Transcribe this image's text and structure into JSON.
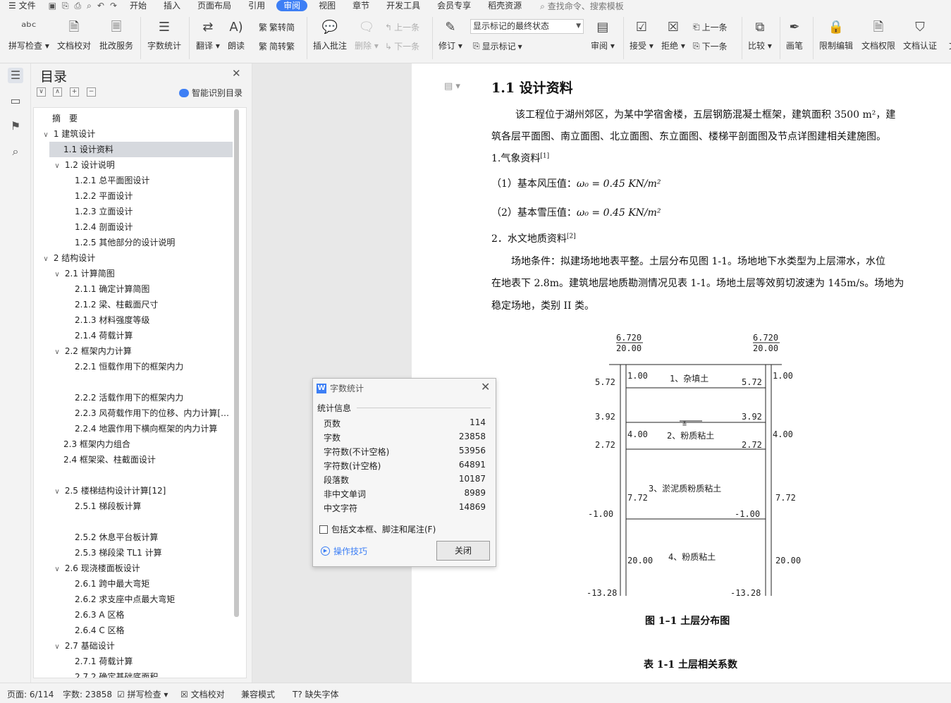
{
  "menubar": {
    "file": "文件",
    "tabs": [
      "开始",
      "插入",
      "页面布局",
      "引用",
      "审阅",
      "视图",
      "章节",
      "开发工具",
      "会员专享",
      "稻壳资源"
    ],
    "active_tab": "审阅",
    "search_placeholder": "查找命令、搜索模板"
  },
  "ribbon": {
    "spell_check": "拼写检查",
    "doc_proof": "文档校对",
    "revise_service": "批改服务",
    "word_count": "字数统计",
    "translate": "翻译",
    "read_aloud": "朗读",
    "trad_to_simp": "繁转简",
    "simp_to_trad": "简转繁",
    "insert_comment": "插入批注",
    "delete": "删除",
    "prev_comment": "上一条",
    "next_comment": "下一条",
    "track_changes": "修订",
    "markup_select": "显示标记的最终状态",
    "show_markup": "显示标记",
    "review": "审阅",
    "accept": "接受",
    "reject": "拒绝",
    "prev_change": "上一条",
    "next_change": "下一条",
    "compare": "比较",
    "pen": "画笔",
    "restrict_edit": "限制编辑",
    "doc_permission": "文档权限",
    "doc_cert": "文档认证",
    "cut_off": "文"
  },
  "nav": {
    "title": "目录",
    "smart_toc": "智能识别目录",
    "items": [
      {
        "text": "摘　要",
        "level": 0,
        "toggle": ""
      },
      {
        "text": "1  建筑设计",
        "level": 0,
        "toggle": "∨"
      },
      {
        "text": "1.1  设计资料",
        "level": 1,
        "toggle": "",
        "selected": true
      },
      {
        "text": "1.2 设计说明",
        "level": 1,
        "toggle": "∨"
      },
      {
        "text": "1.2.1 总平面图设计",
        "level": 2,
        "toggle": ""
      },
      {
        "text": "1.2.2  平面设计",
        "level": 2,
        "toggle": ""
      },
      {
        "text": "1.2.3  立面设计",
        "level": 2,
        "toggle": ""
      },
      {
        "text": "1.2.4  剖面设计",
        "level": 2,
        "toggle": ""
      },
      {
        "text": "1.2.5  其他部分的设计说明",
        "level": 2,
        "toggle": ""
      },
      {
        "text": "2  结构设计",
        "level": 0,
        "toggle": "∨"
      },
      {
        "text": "2.1 计算简图",
        "level": 1,
        "toggle": "∨"
      },
      {
        "text": "2.1.1 确定计算简图",
        "level": 2,
        "toggle": ""
      },
      {
        "text": "2.1.2 梁、柱截面尺寸",
        "level": 2,
        "toggle": ""
      },
      {
        "text": "2.1.3 材料强度等级",
        "level": 2,
        "toggle": ""
      },
      {
        "text": "2.1.4 荷载计算",
        "level": 2,
        "toggle": ""
      },
      {
        "text": "2.2 框架内力计算",
        "level": 1,
        "toggle": "∨"
      },
      {
        "text": "2.2.1 恒载作用下的框架内力",
        "level": 2,
        "toggle": ""
      },
      {
        "text": "",
        "level": 2,
        "toggle": ""
      },
      {
        "text": "2.2.2 活载作用下的框架内力",
        "level": 2,
        "toggle": ""
      },
      {
        "text": "2.2.3 风荷载作用下的位移、内力计算[…",
        "level": 2,
        "toggle": ""
      },
      {
        "text": "2.2.4 地震作用下横向框架的内力计算",
        "level": 2,
        "toggle": ""
      },
      {
        "text": "2.3 框架内力组合",
        "level": 1,
        "toggle": ""
      },
      {
        "text": "2.4 框架梁、柱截面设计",
        "level": 1,
        "toggle": ""
      },
      {
        "text": "",
        "level": 1,
        "toggle": ""
      },
      {
        "text": "2.5 楼梯结构设计计算[12]",
        "level": 1,
        "toggle": "∨"
      },
      {
        "text": "2.5.1 梯段板计算",
        "level": 2,
        "toggle": ""
      },
      {
        "text": "",
        "level": 2,
        "toggle": ""
      },
      {
        "text": "2.5.2 休息平台板计算",
        "level": 2,
        "toggle": ""
      },
      {
        "text": "2.5.3 梯段梁 TL1 计算",
        "level": 2,
        "toggle": ""
      },
      {
        "text": "2.6 现浇楼面板设计",
        "level": 1,
        "toggle": "∨"
      },
      {
        "text": "2.6.1 跨中最大弯矩",
        "level": 2,
        "toggle": ""
      },
      {
        "text": "2.6.2 求支座中点最大弯矩",
        "level": 2,
        "toggle": ""
      },
      {
        "text": "2.6.3 A 区格",
        "level": 2,
        "toggle": ""
      },
      {
        "text": "2.6.4 C 区格",
        "level": 2,
        "toggle": ""
      },
      {
        "text": "2.7 基础设计",
        "level": 1,
        "toggle": "∨"
      },
      {
        "text": "2.7.1 荷载计算",
        "level": 2,
        "toggle": ""
      },
      {
        "text": "2.7.2 确定基础底面积",
        "level": 2,
        "toggle": ""
      }
    ]
  },
  "doc": {
    "heading": "1.1  设计资料",
    "p1a": "该工程位于湖州郊区，为某中学宿舍楼，五层钢筋混凝土框架，建筑面积 3500 m²，建",
    "p1b": "筑各层平面图、南立面图、北立面图、东立面图、楼梯平剖面图及节点详图建相关建施图。",
    "s1": "1.气象资料",
    "s1ref": "[1]",
    "wind_label": "（1）基本风压值：",
    "snow_label": "（2）基本雪压值：",
    "formula": "ω₀ = 0.45 KN/m²",
    "s2": "2．水文地质资料",
    "s2ref": "[2]",
    "p2a": "场地条件：拟建场地地表平整。土层分布见图 1-1。场地地下水类型为上层滞水，水位",
    "p2b": "在地表下 2.8m。建筑地层地质勘测情况见表 1-1。场地土层等效剪切波速为 145m/s。场地为",
    "p2c": "稳定场地，类别 II 类。",
    "fig_caption": "图 1–1     土层分布图",
    "table_caption": "表 1-1    土层相关系数",
    "figure": {
      "top_left_a": "6.720",
      "top_left_b": "20.00",
      "top_right_a": "6.720",
      "top_right_b": "20.00",
      "left_levels": [
        "5.72",
        "3.92",
        "2.72",
        "-1.00",
        "-13.28"
      ],
      "right_levels": [
        "5.72",
        "3.92",
        "2.72",
        "-1.00",
        "-13.28"
      ],
      "thick_left": [
        "1.00",
        "4.00",
        "7.72",
        "20.00"
      ],
      "thick_right": [
        "1.00",
        "4.00",
        "7.72",
        "20.00"
      ],
      "layers": [
        "1、杂填土",
        "2、粉质粘土",
        "3、淤泥质粉质粘土",
        "4、粉质粘土"
      ]
    }
  },
  "dialog": {
    "title": "字数统计",
    "group": "统计信息",
    "rows": [
      {
        "label": "页数",
        "value": "114"
      },
      {
        "label": "字数",
        "value": "23858"
      },
      {
        "label": "字符数(不计空格)",
        "value": "53956"
      },
      {
        "label": "字符数(计空格)",
        "value": "64891"
      },
      {
        "label": "段落数",
        "value": "10187"
      },
      {
        "label": "非中文单词",
        "value": "8989"
      },
      {
        "label": "中文字符",
        "value": "14869"
      }
    ],
    "checkbox": "包括文本框、脚注和尾注(F)",
    "tips": "操作技巧",
    "close": "关闭"
  },
  "status": {
    "page": "页面: 6/114",
    "words": "字数: 23858",
    "spell": "拼写检查",
    "proof": "文档校对",
    "compat": "兼容模式",
    "missing_font": "缺失字体"
  }
}
